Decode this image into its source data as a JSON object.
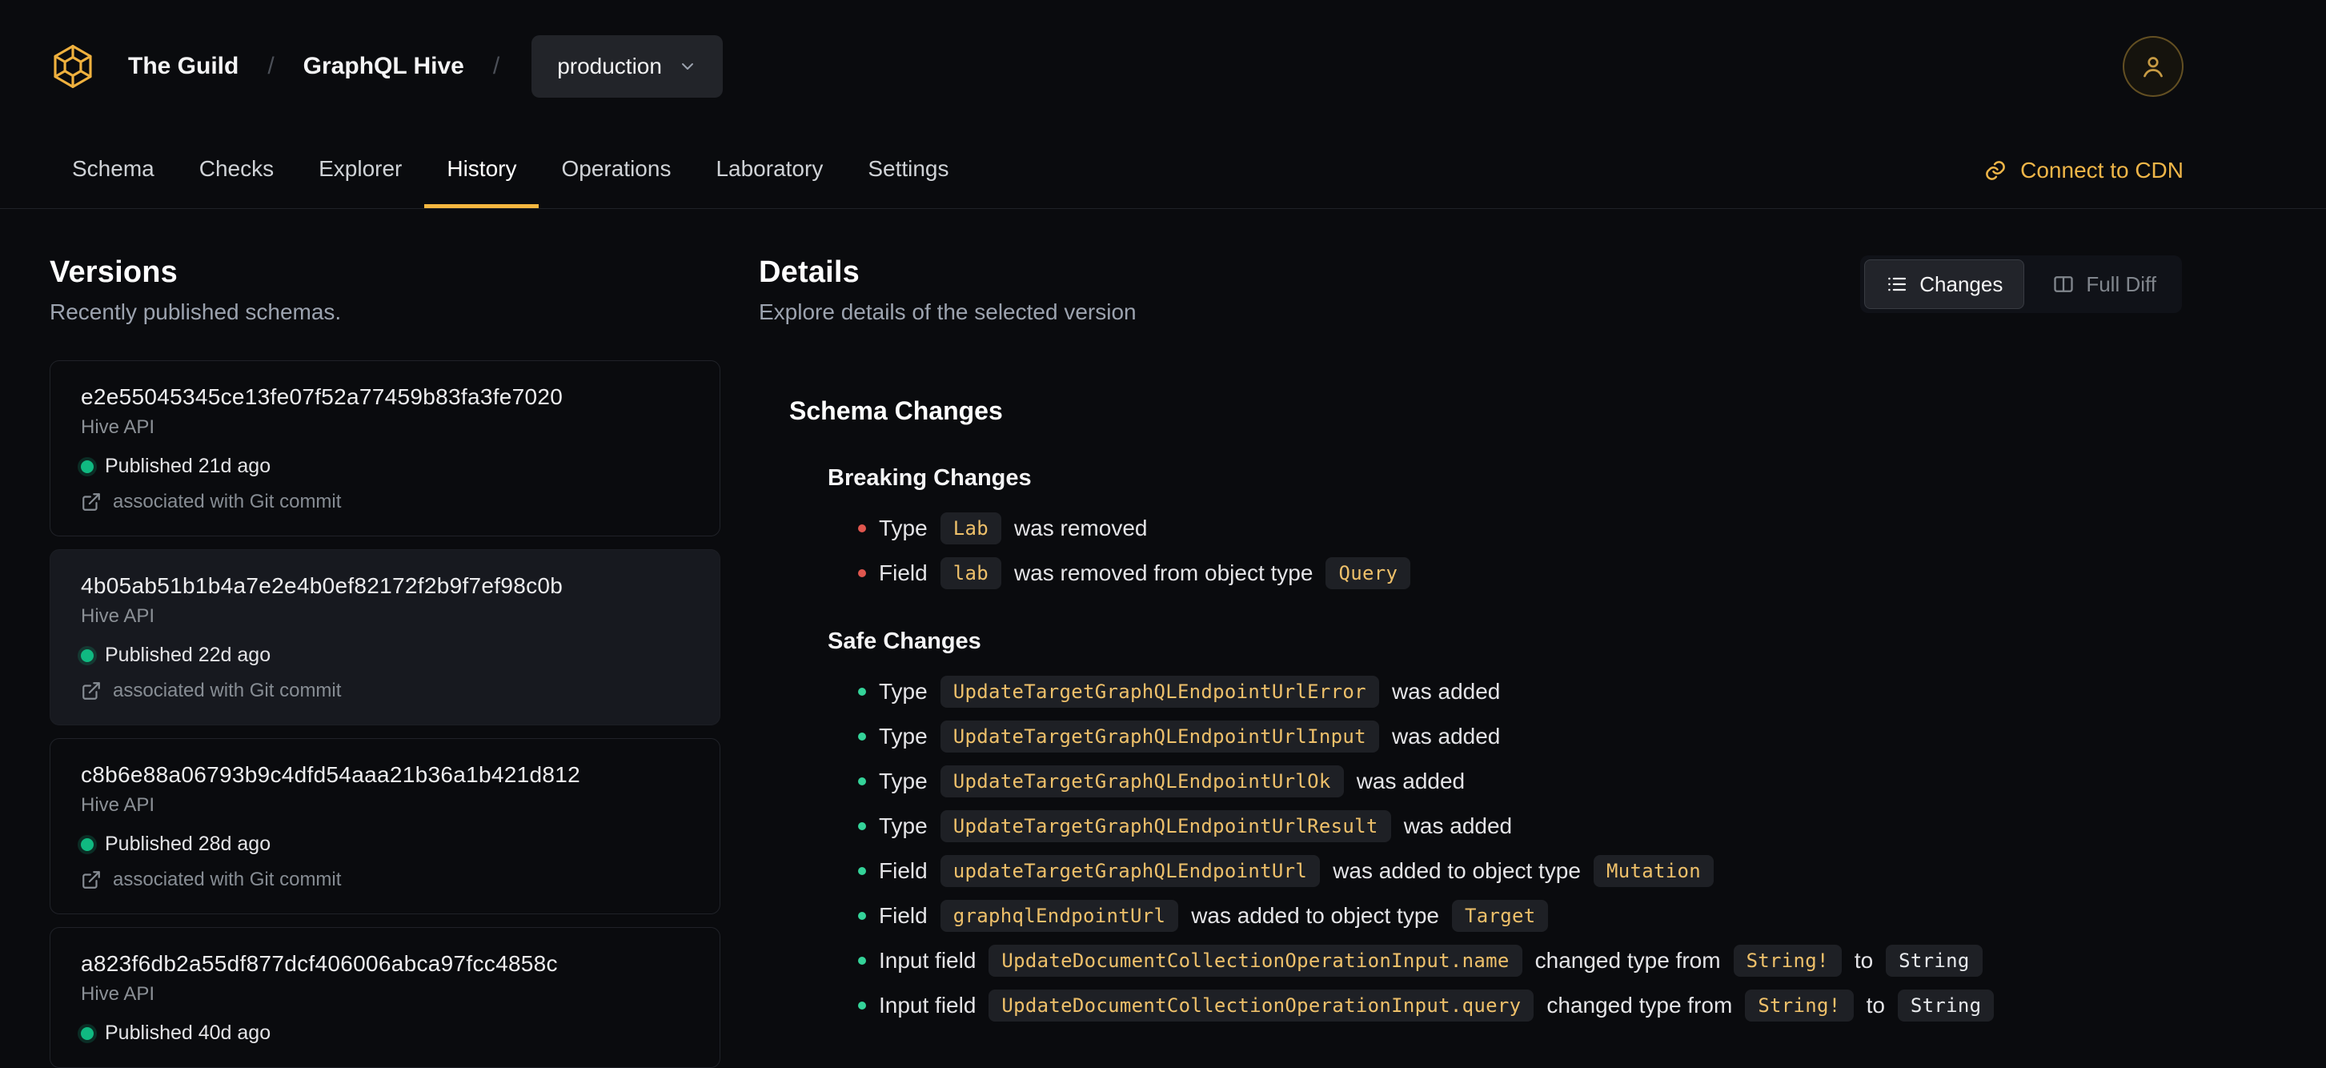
{
  "brand": {
    "accent_color": "#f4b740",
    "logo_icon": "hive-hexagon-logo-icon"
  },
  "header": {
    "breadcrumb": {
      "org": "The Guild",
      "separator": "/",
      "project": "GraphQL Hive"
    },
    "environment_selector": {
      "value": "production",
      "chevron_icon": "chevron-down-icon"
    },
    "avatar_icon": "user-icon",
    "tabs": [
      {
        "label": "Schema",
        "active": false
      },
      {
        "label": "Checks",
        "active": false
      },
      {
        "label": "Explorer",
        "active": false
      },
      {
        "label": "History",
        "active": true
      },
      {
        "label": "Operations",
        "active": false
      },
      {
        "label": "Laboratory",
        "active": false
      },
      {
        "label": "Settings",
        "active": false
      }
    ],
    "cdn_link": {
      "label": "Connect to CDN",
      "icon": "link-icon"
    }
  },
  "versions": {
    "title": "Versions",
    "subtitle": "Recently published schemas.",
    "items": [
      {
        "hash": "e2e55045345ce13fe07f52a77459b83fa3fe7020",
        "service": "Hive API",
        "published": "Published 21d ago",
        "commit": "associated with Git commit",
        "selected": false
      },
      {
        "hash": "4b05ab51b1b4a7e2e4b0ef82172f2b9f7ef98c0b",
        "service": "Hive API",
        "published": "Published 22d ago",
        "commit": "associated with Git commit",
        "selected": true
      },
      {
        "hash": "c8b6e88a06793b9c4dfd54aaa21b36a1b421d812",
        "service": "Hive API",
        "published": "Published 28d ago",
        "commit": "associated with Git commit",
        "selected": false
      },
      {
        "hash": "a823f6db2a55df877dcf406006abca97fcc4858c",
        "service": "Hive API",
        "published": "Published 40d ago",
        "commit": "",
        "selected": false
      }
    ]
  },
  "details": {
    "title": "Details",
    "subtitle": "Explore details of the selected version",
    "view_toggle": [
      {
        "label": "Changes",
        "icon": "list-icon",
        "active": true
      },
      {
        "label": "Full Diff",
        "icon": "diff-columns-icon",
        "active": false
      }
    ],
    "schema_changes": {
      "title": "Schema Changes",
      "groups": [
        {
          "title": "Breaking Changes",
          "severity": "breaking",
          "items": [
            {
              "parts": [
                {
                  "kind": "text",
                  "value": "Type"
                },
                {
                  "kind": "code",
                  "value": "Lab"
                },
                {
                  "kind": "text",
                  "value": "was removed"
                }
              ]
            },
            {
              "parts": [
                {
                  "kind": "text",
                  "value": "Field"
                },
                {
                  "kind": "code",
                  "value": "lab"
                },
                {
                  "kind": "text",
                  "value": "was removed from object type"
                },
                {
                  "kind": "code",
                  "value": "Query"
                }
              ]
            }
          ]
        },
        {
          "title": "Safe Changes",
          "severity": "safe",
          "items": [
            {
              "parts": [
                {
                  "kind": "text",
                  "value": "Type"
                },
                {
                  "kind": "code",
                  "value": "UpdateTargetGraphQLEndpointUrlError"
                },
                {
                  "kind": "text",
                  "value": "was added"
                }
              ]
            },
            {
              "parts": [
                {
                  "kind": "text",
                  "value": "Type"
                },
                {
                  "kind": "code",
                  "value": "UpdateTargetGraphQLEndpointUrlInput"
                },
                {
                  "kind": "text",
                  "value": "was added"
                }
              ]
            },
            {
              "parts": [
                {
                  "kind": "text",
                  "value": "Type"
                },
                {
                  "kind": "code",
                  "value": "UpdateTargetGraphQLEndpointUrlOk"
                },
                {
                  "kind": "text",
                  "value": "was added"
                }
              ]
            },
            {
              "parts": [
                {
                  "kind": "text",
                  "value": "Type"
                },
                {
                  "kind": "code",
                  "value": "UpdateTargetGraphQLEndpointUrlResult"
                },
                {
                  "kind": "text",
                  "value": "was added"
                }
              ]
            },
            {
              "parts": [
                {
                  "kind": "text",
                  "value": "Field"
                },
                {
                  "kind": "code",
                  "value": "updateTargetGraphQLEndpointUrl"
                },
                {
                  "kind": "text",
                  "value": "was added to object type"
                },
                {
                  "kind": "code",
                  "value": "Mutation"
                }
              ]
            },
            {
              "parts": [
                {
                  "kind": "text",
                  "value": "Field"
                },
                {
                  "kind": "code",
                  "value": "graphqlEndpointUrl"
                },
                {
                  "kind": "text",
                  "value": "was added to object type"
                },
                {
                  "kind": "code",
                  "value": "Target"
                }
              ]
            },
            {
              "parts": [
                {
                  "kind": "text",
                  "value": "Input field"
                },
                {
                  "kind": "code",
                  "value": "UpdateDocumentCollectionOperationInput.name"
                },
                {
                  "kind": "text",
                  "value": "changed type from"
                },
                {
                  "kind": "code",
                  "value": "String!"
                },
                {
                  "kind": "text",
                  "value": "to"
                },
                {
                  "kind": "code-plain",
                  "value": "String"
                }
              ]
            },
            {
              "parts": [
                {
                  "kind": "text",
                  "value": "Input field"
                },
                {
                  "kind": "code",
                  "value": "UpdateDocumentCollectionOperationInput.query"
                },
                {
                  "kind": "text",
                  "value": "changed type from"
                },
                {
                  "kind": "code",
                  "value": "String!"
                },
                {
                  "kind": "text",
                  "value": "to"
                },
                {
                  "kind": "code-plain",
                  "value": "String"
                }
              ]
            }
          ]
        }
      ]
    }
  },
  "status_colors": {
    "published_dot": "#10b981",
    "breaking_bullet": "#e0564e",
    "safe_bullet": "#34d399"
  }
}
